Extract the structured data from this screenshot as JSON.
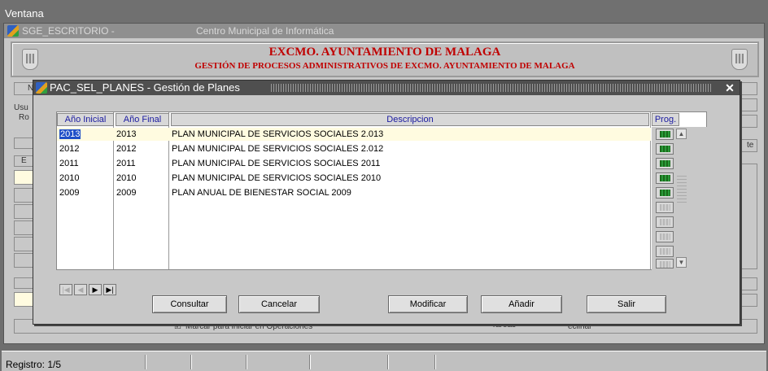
{
  "menubar": {
    "label": "Ventana"
  },
  "mdi_window": {
    "title_left": "SGE_ESCRITORIO -",
    "title_right": "Centro Municipal de Informática"
  },
  "header": {
    "title": "EXCMO. AYUNTAMIENTO DE MALAGA",
    "subtitle": "GESTIÓN DE PROCESOS ADMINISTRATIVOS DE EXCMO. AYUNTAMIENTO DE MALAGA"
  },
  "background": {
    "frag_n": "N",
    "frag_usu": "Usu",
    "frag_ro": "Ro",
    "frag_e": "E",
    "frag_te": "te",
    "checkbox_label": "Marcar para iniciar en Operaciones",
    "tareas_label": "Tareas",
    "rechazar_label": "eclinar"
  },
  "dialog": {
    "title": "PAC_SEL_PLANES - Gestión de Planes",
    "columns": {
      "ano_inicial": "Año Inicial",
      "ano_final": "Año Final",
      "descripcion": "Descripcion",
      "prog": "Prog."
    },
    "rows": [
      {
        "ano_inicial": "2013",
        "ano_final": "2013",
        "descripcion": "PLAN MUNICIPAL DE SERVICIOS SOCIALES 2.013"
      },
      {
        "ano_inicial": "2012",
        "ano_final": "2012",
        "descripcion": "PLAN MUNICIPAL DE SERVICIOS SOCIALES 2.012"
      },
      {
        "ano_inicial": "2011",
        "ano_final": "2011",
        "descripcion": "PLAN MUNICIPAL DE SERVICIOS SOCIALES 2011"
      },
      {
        "ano_inicial": "2010",
        "ano_final": "2010",
        "descripcion": "PLAN MUNICIPAL DE SERVICIOS SOCIALES 2010"
      },
      {
        "ano_inicial": "2009",
        "ano_final": "2009",
        "descripcion": "PLAN ANUAL DE BIENESTAR SOCIAL 2009"
      }
    ],
    "buttons": {
      "consultar": "Consultar",
      "cancelar": "Cancelar",
      "modificar": "Modificar",
      "anadir": "Añadir",
      "salir": "Salir"
    }
  },
  "status": {
    "text": "Registro: 1/5"
  }
}
